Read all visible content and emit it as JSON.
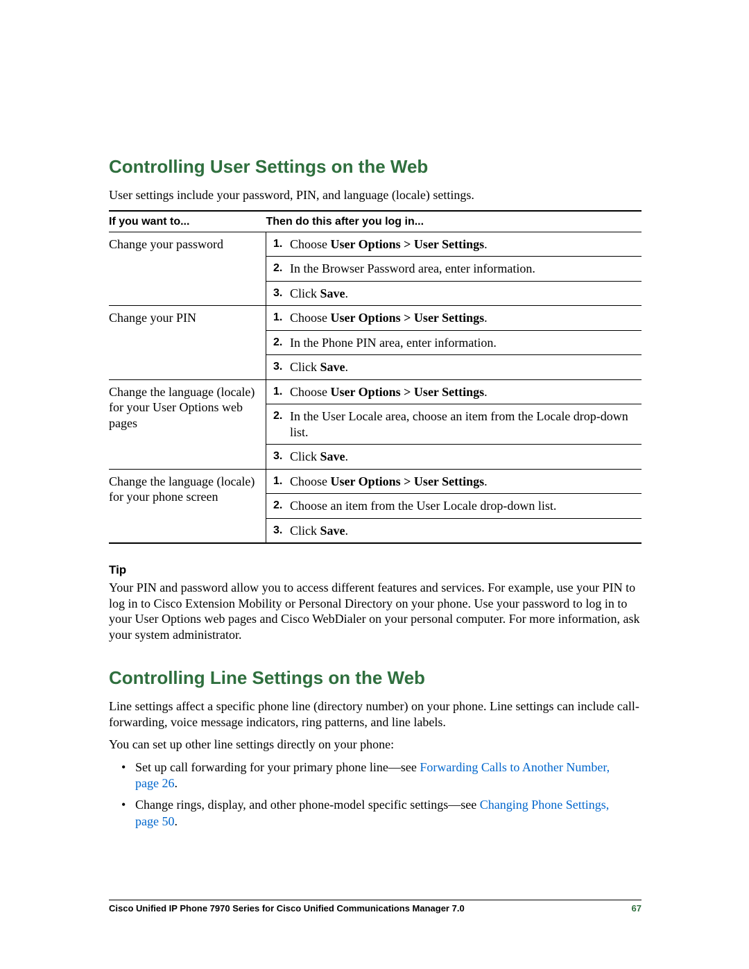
{
  "section1": {
    "heading": "Controlling User Settings on the Web",
    "intro": "User settings include your password, PIN, and language (locale) settings.",
    "table": {
      "head_left": "If you want to...",
      "head_right": "Then do this after you log in...",
      "rows": [
        {
          "left": "Change your password",
          "steps": [
            {
              "pre": "Choose ",
              "bold": "User Options > User Settings",
              "post": "."
            },
            {
              "pre": "In the Browser Password area, enter information.",
              "bold": "",
              "post": ""
            },
            {
              "pre": "Click ",
              "bold": "Save",
              "post": "."
            }
          ]
        },
        {
          "left": "Change your PIN",
          "steps": [
            {
              "pre": "Choose ",
              "bold": "User Options > User Settings",
              "post": "."
            },
            {
              "pre": "In the Phone PIN area, enter information.",
              "bold": "",
              "post": ""
            },
            {
              "pre": "Click ",
              "bold": "Save",
              "post": "."
            }
          ]
        },
        {
          "left": "Change the language (locale) for your User Options web pages",
          "steps": [
            {
              "pre": "Choose ",
              "bold": "User Options > User Settings",
              "post": "."
            },
            {
              "pre": "In the User Locale area, choose an item from the Locale drop-down list.",
              "bold": "",
              "post": ""
            },
            {
              "pre": "Click ",
              "bold": "Save",
              "post": "."
            }
          ]
        },
        {
          "left": "Change the language (locale) for your phone screen",
          "steps": [
            {
              "pre": "Choose ",
              "bold": "User Options > User Settings",
              "post": "."
            },
            {
              "pre": "Choose an item from the User Locale drop-down list.",
              "bold": "",
              "post": ""
            },
            {
              "pre": "Click ",
              "bold": "Save",
              "post": "."
            }
          ]
        }
      ]
    },
    "tip_heading": "Tip",
    "tip_body": "Your PIN and password allow you to access different features and services. For example, use your PIN to log in to Cisco Extension Mobility or Personal Directory on your phone. Use your password to log in to your User Options web pages and Cisco WebDialer on your personal computer. For more information, ask your system administrator."
  },
  "section2": {
    "heading": "Controlling Line Settings on the Web",
    "para1": "Line settings affect a specific phone line (directory number) on your phone. Line settings can include call-forwarding, voice message indicators, ring patterns, and line labels.",
    "para2": "You can set up other line settings directly on your phone:",
    "bullets": [
      {
        "pre": "Set up call forwarding for your primary phone line—see ",
        "link": "Forwarding Calls to Another Number, page 26",
        "post": "."
      },
      {
        "pre": "Change rings, display, and other phone-model specific settings—see ",
        "link": "Changing Phone Settings, page 50",
        "post": "."
      }
    ]
  },
  "footer": {
    "title": "Cisco Unified IP Phone 7970 Series for Cisco Unified Communications Manager 7.0",
    "pagenum": "67"
  }
}
